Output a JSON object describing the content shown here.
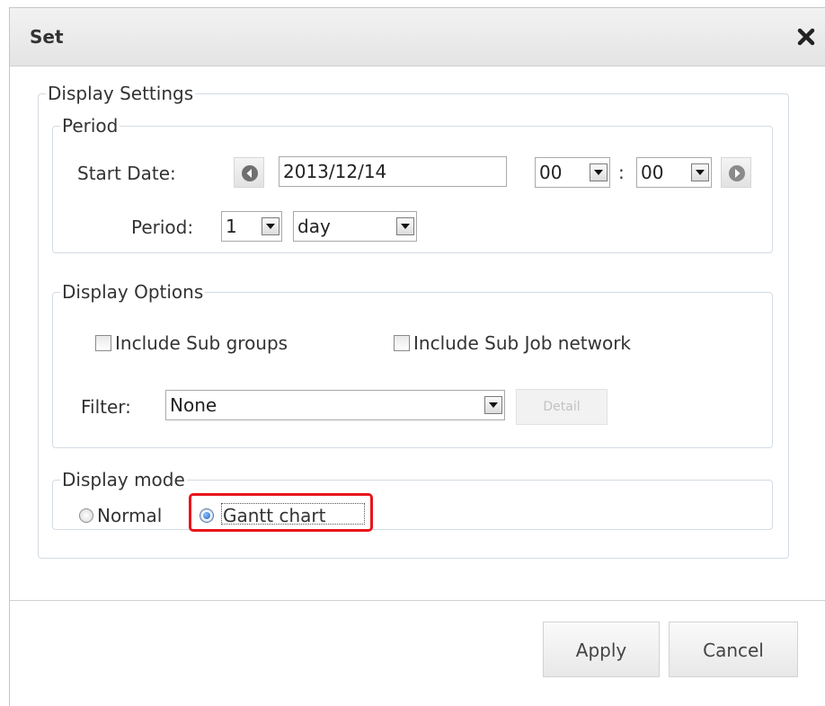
{
  "dialog": {
    "title": "Set",
    "close_icon": "close-icon"
  },
  "display_settings": {
    "legend": "Display Settings",
    "period_group": {
      "legend": "Period",
      "start_date_label": "Start Date:",
      "start_date_value": "2013/12/14",
      "hour_value": "00",
      "time_separator": ":",
      "minute_value": "00",
      "period_label": "Period:",
      "period_count": "1",
      "period_unit": "day"
    },
    "options_group": {
      "legend": "Display Options",
      "include_sub_groups": {
        "label": "Include Sub groups",
        "checked": false
      },
      "include_sub_job_network": {
        "label": "Include Sub Job network",
        "checked": false
      },
      "filter_label": "Filter:",
      "filter_value": "None",
      "detail_button": "Detail"
    },
    "mode_group": {
      "legend": "Display mode",
      "normal_label": "Normal",
      "gantt_label": "Gantt chart",
      "selected": "Gantt chart"
    }
  },
  "footer": {
    "apply_button": "Apply",
    "cancel_button": "Cancel"
  },
  "colors": {
    "highlight": "#e8151b",
    "titlebar": "#e9e9e9"
  }
}
